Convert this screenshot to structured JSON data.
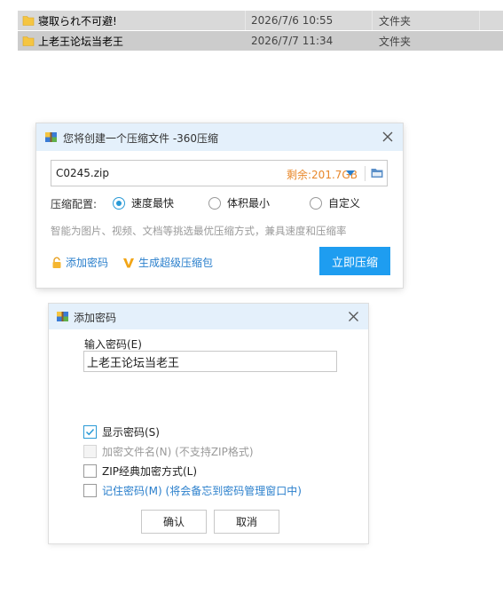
{
  "files": [
    {
      "name": "寝取られ不可避!",
      "date": "2026/7/6 10:55",
      "type": "文件夹"
    },
    {
      "name": "上老王论坛当老王",
      "date": "2026/7/7 11:34",
      "type": "文件夹"
    }
  ],
  "compress_dialog": {
    "title": "您将创建一个压缩文件 -360压缩",
    "filename": "C0245.zip",
    "free_space": "剩余:201.7GB",
    "config_label": "压缩配置:",
    "options": [
      "速度最快",
      "体积最小",
      "自定义"
    ],
    "selected_option": "速度最快",
    "hint": "智能为图片、视频、文档等挑选最优压缩方式，兼具速度和压缩率",
    "add_password": "添加密码",
    "super_compress": "生成超级压缩包",
    "compress_button": "立即压缩"
  },
  "password_dialog": {
    "title": "添加密码",
    "input_label": "输入密码(E)",
    "password_value": "上老王论坛当老王",
    "show_password": "显示密码(S)",
    "show_password_checked": true,
    "encrypt_filenames": "加密文件名(N) (不支持ZIP格式)",
    "zip_classic": "ZIP经典加密方式(L)",
    "remember_password": "记住密码(M) (将会备忘到密码管理窗口中)",
    "ok": "确认",
    "cancel": "取消"
  },
  "colors": {
    "accent": "#1e9df0",
    "title_bar": "#e4f0fb",
    "free_space": "#e8872a",
    "link": "#2a7fcc"
  }
}
